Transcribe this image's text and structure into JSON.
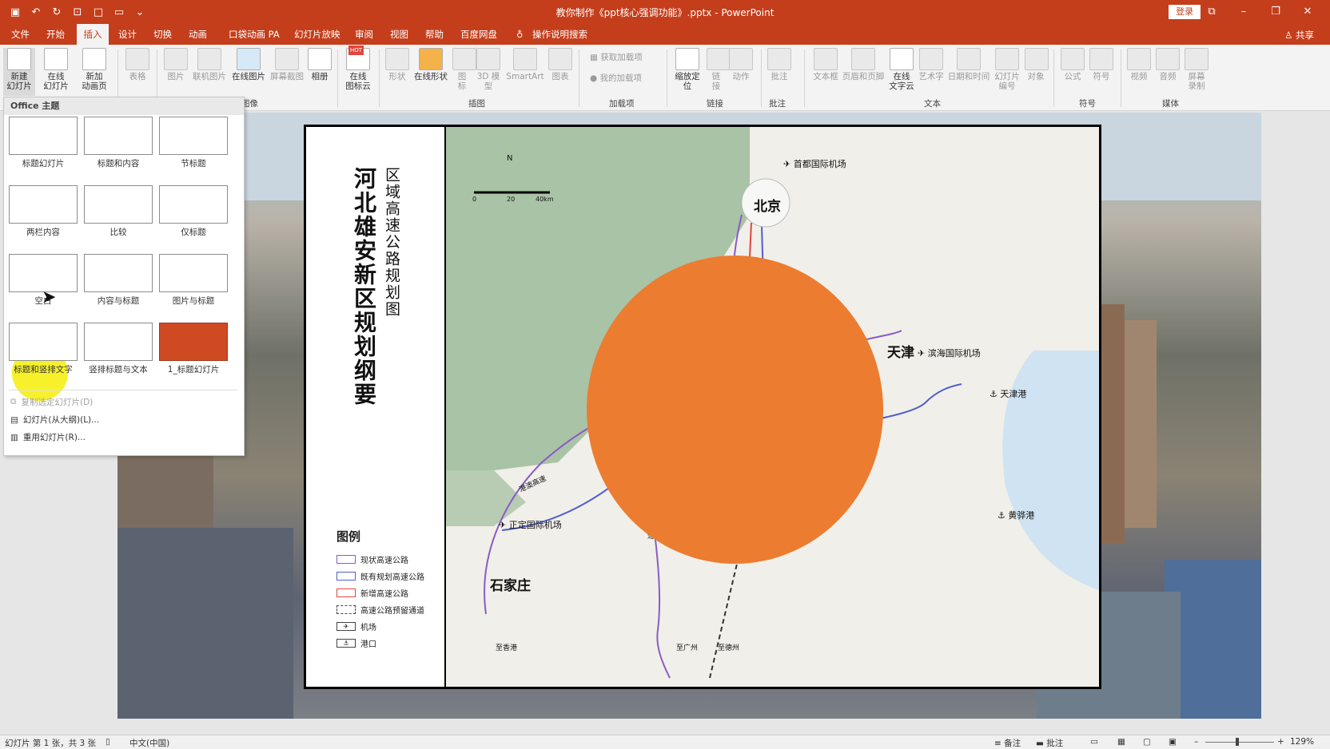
{
  "title_bar": {
    "doc_title": "教你制作《ppt核心强调功能》.pptx - PowerPoint",
    "login": "登录"
  },
  "tabs": [
    "文件",
    "开始",
    "插入",
    "设计",
    "切换",
    "动画",
    "口袋动画 PA",
    "幻灯片放映",
    "审阅",
    "视图",
    "帮助",
    "百度网盘",
    "操作说明搜索"
  ],
  "share": "共享",
  "ribbon": {
    "new_slide": "新建\n幻灯片",
    "online_slide": "在线\n幻灯片",
    "new_anim_page": "新加\n动画页",
    "table": "表格",
    "picture": "图片",
    "online_picture": "联机图片",
    "online_picture2": "在线图片",
    "screenshot": "屏幕截图",
    "album": "相册",
    "online_icons": "在线\n图标云",
    "hot": "HOT",
    "shapes": "形状",
    "online_shapes": "在线形状",
    "icons": "图\n标",
    "model3d": "3D 模\n型",
    "smartart": "SmartArt",
    "chart": "图表",
    "get_addins": "获取加载项",
    "my_addins": "我的加载项",
    "zoom": "缩放定\n位",
    "link": "链\n接",
    "action": "动作",
    "comment": "批注",
    "textbox": "文本框",
    "header_footer": "页眉和页脚",
    "online_wordart": "在线\n文字云",
    "wordart": "艺术字",
    "date_time": "日期和时间",
    "slide_number": "幻灯片\n编号",
    "object": "对象",
    "equation": "公式",
    "symbol": "符号",
    "video": "视频",
    "audio": "音频",
    "screen_record": "屏幕\n录制",
    "groups": [
      "图像",
      "插图",
      "加载项",
      "链接",
      "批注",
      "文本",
      "符号",
      "媒体"
    ]
  },
  "layout_panel": {
    "header": "Office 主题",
    "layouts": [
      "标题幻灯片",
      "标题和内容",
      "节标题",
      "两栏内容",
      "比较",
      "仅标题",
      "空白",
      "内容与标题",
      "图片与标题",
      "标题和竖排文字",
      "竖排标题与文本",
      "1_标题幻灯片"
    ],
    "commands": [
      "复制选定幻灯片(D)",
      "幻灯片(从大纲)(L)...",
      "重用幻灯片(R)..."
    ]
  },
  "map": {
    "main_title": "河北雄安新区规划纲要",
    "sub_title": "区域高速公路规划图",
    "legend_title": "图例",
    "legend": [
      "现状高速公路",
      "既有规划高速公路",
      "新增高速公路",
      "高速公路预留通道",
      "机场",
      "港口"
    ],
    "legend_colors": [
      "#8a5bc7",
      "#4f5fd0",
      "#e0463c",
      "#333333",
      "#111111",
      "#111111"
    ],
    "cities": {
      "beijing": "北京",
      "tianjin": "天津",
      "shijiazhuang": "石家庄"
    },
    "labels": {
      "capital_airport": "首都国际机场",
      "binhai_airport": "滨海国际机场",
      "tianjin_port": "天津港",
      "huanghua_port": "黄骅港",
      "zhengding_airport": "正定国际机场",
      "to_hongkong": "至香港",
      "to_guangzhou": "至广州",
      "to_dezhou": "至德州",
      "scale_0": "0",
      "scale_20": "20",
      "scale_40": "40km",
      "north": "N",
      "expressway": "港澳高速",
      "road_gao": "高",
      "road_su": "速",
      "road_jing": "京",
      "su_partial": "速)"
    }
  },
  "status": {
    "slide_info": "幻灯片 第 1 张，共 3 张",
    "language": "中文(中国)",
    "notes": "备注",
    "comments": "批注",
    "zoom": "129%"
  }
}
